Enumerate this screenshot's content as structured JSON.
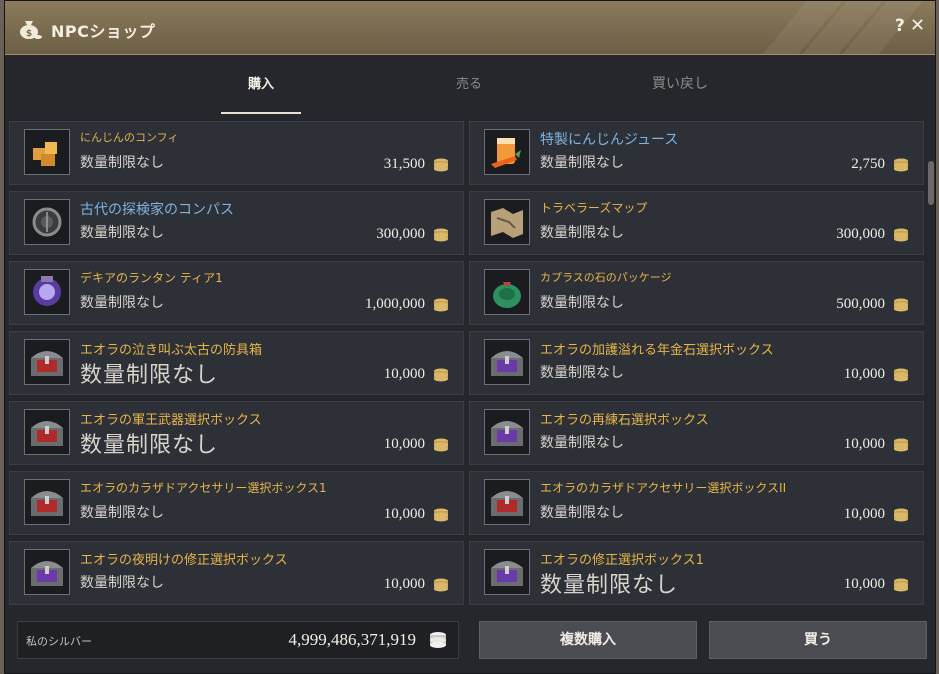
{
  "window": {
    "title": "NPCショップ",
    "help_label": "?",
    "close_label": "✕"
  },
  "tabs": [
    {
      "label": "購入",
      "active": true
    },
    {
      "label": "売る",
      "active": false
    },
    {
      "label": "買い戻し",
      "active": false
    }
  ],
  "items": [
    {
      "name": "にんじんのコンフィ",
      "limit": "数量制限なし",
      "price": "31,500",
      "icon": "carrot-confit-icon"
    },
    {
      "name": "特製にんじんジュース",
      "limit": "数量制限なし",
      "price": "2,750",
      "icon": "carrot-juice-icon"
    },
    {
      "name": "古代の探検家のコンパス",
      "limit": "数量制限なし",
      "price": "300,000",
      "icon": "compass-icon"
    },
    {
      "name": "トラベラーズマップ",
      "limit": "数量制限なし",
      "price": "300,000",
      "icon": "map-icon"
    },
    {
      "name": "デキアのランタン ティア1",
      "limit": "数量制限なし",
      "price": "1,000,000",
      "icon": "lantern-icon"
    },
    {
      "name": "カプラスの石のパッケージ",
      "limit": "数量制限なし",
      "price": "500,000",
      "icon": "stone-package-icon"
    },
    {
      "name": "エオラの泣き叫ぶ太古の防具箱",
      "limit": "数量制限なし",
      "price": "10,000",
      "icon": "chest-red-icon"
    },
    {
      "name": "エオラの加護溢れる年金石選択ボックス",
      "limit": "数量制限なし",
      "price": "10,000",
      "icon": "chest-purple-icon"
    },
    {
      "name": "エオラの軍王武器選択ボックス",
      "limit": "数量制限なし",
      "price": "10,000",
      "icon": "chest-red-icon"
    },
    {
      "name": "エオラの再練石選択ボックス",
      "limit": "数量制限なし",
      "price": "10,000",
      "icon": "chest-purple-icon"
    },
    {
      "name": "エオラのカラザドアクセサリー選択ボックス1",
      "limit": "数量制限なし",
      "price": "10,000",
      "icon": "chest-red-icon"
    },
    {
      "name": "エオラのカラザドアクセサリー選択ボックスII",
      "limit": "数量制限なし",
      "price": "10,000",
      "icon": "chest-red-icon"
    },
    {
      "name": "エオラの夜明けの修正選択ボックス",
      "limit": "数量制限なし",
      "price": "10,000",
      "icon": "chest-purple-icon"
    },
    {
      "name": "エオラの修正選択ボックス1",
      "limit": "数量制限なし",
      "price": "10,000",
      "icon": "chest-purple-icon"
    }
  ],
  "footer": {
    "silver_label": "私のシルバー",
    "silver_value": "4,999,486,371,919",
    "bulk_buy_label": "複数購入",
    "buy_label": "買う"
  },
  "colors": {
    "item_name_gold": "#e6b54a",
    "item_name_blue": "#7fb3e0",
    "titlebar": "#7a6b4f"
  }
}
